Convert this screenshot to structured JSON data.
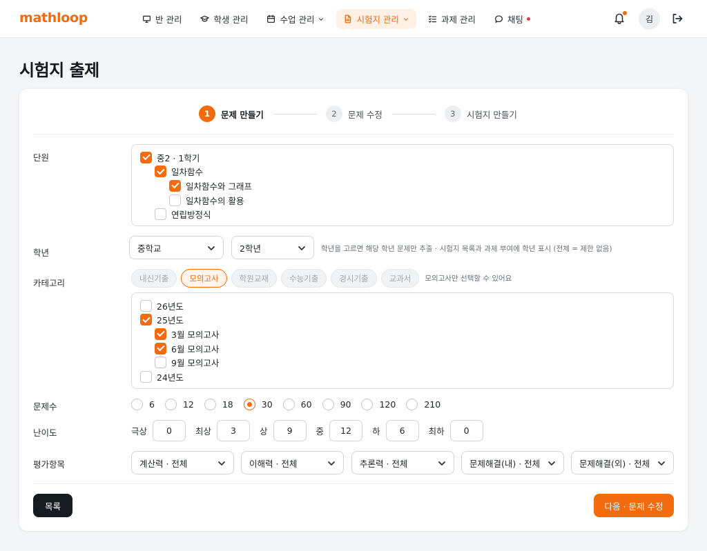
{
  "brand": {
    "logo": "mathloop",
    "accent": "#f26b0f"
  },
  "nav": {
    "items": [
      {
        "label": "반 관리",
        "icon": "monitor-icon"
      },
      {
        "label": "학생 관리",
        "icon": "graduation-cap-icon"
      },
      {
        "label": "수업 관리",
        "icon": "calendar-icon"
      },
      {
        "label": "시험지 관리",
        "icon": "document-icon"
      },
      {
        "label": "과제 관리",
        "icon": "checklist-icon"
      },
      {
        "label": "채팅",
        "icon": "chat-bubble-icon"
      }
    ],
    "active": "시험지 관리",
    "avatar": "김"
  },
  "page": {
    "title": "시험지 출제"
  },
  "stepper": {
    "steps": [
      {
        "num": "1",
        "label": "문제 만들기"
      },
      {
        "num": "2",
        "label": "문제 수정"
      },
      {
        "num": "3",
        "label": "시험지 만들기"
      }
    ],
    "current": "1"
  },
  "unit": {
    "label": "단원",
    "items": [
      {
        "label": "중2 · 1학기",
        "checked": true
      },
      {
        "label": "일차함수",
        "checked": true
      },
      {
        "label": "일차함수와 그래프",
        "checked": true
      },
      {
        "label": "일차함수의 활용",
        "checked": false
      },
      {
        "label": "연립방정식",
        "checked": false
      }
    ]
  },
  "grade": {
    "label": "학년",
    "school": "중학교",
    "year": "2학년",
    "hint": "학년을 고르면 해당 학년 문제만 추출 · 시험지 목록과 과제 부여에 학년 표시 (전체 = 제한 없음)"
  },
  "category": {
    "label": "카테고리",
    "chips": [
      "내신기출",
      "모의고사",
      "학원교재",
      "수능기출",
      "경시기출",
      "교과서"
    ],
    "active": "모의고사",
    "hint": "모의고사만 선택할 수 있어요",
    "items": [
      {
        "label": "26년도",
        "checked": false
      },
      {
        "label": "25년도",
        "checked": true
      },
      {
        "label": "3월 모의고사",
        "checked": true
      },
      {
        "label": "6월 모의고사",
        "checked": true
      },
      {
        "label": "9월 모의고사",
        "checked": false
      },
      {
        "label": "24년도",
        "checked": false
      }
    ]
  },
  "count": {
    "label": "문제수",
    "options": [
      "6",
      "12",
      "18",
      "30",
      "60",
      "90",
      "120",
      "210"
    ],
    "selected": "30"
  },
  "difficulty": {
    "label": "난이도",
    "levels": [
      {
        "name": "극상",
        "value": "0"
      },
      {
        "name": "최상",
        "value": "3"
      },
      {
        "name": "상",
        "value": "9"
      },
      {
        "name": "중",
        "value": "12"
      },
      {
        "name": "하",
        "value": "6"
      },
      {
        "name": "최하",
        "value": "0"
      }
    ]
  },
  "assessment": {
    "label": "평가항목",
    "selects": [
      "계산력 · 전체",
      "이해력 · 전체",
      "추론력 · 전체",
      "문제해결(내) · 전체",
      "문제해결(외) · 전체"
    ]
  },
  "actions": {
    "list": "목록",
    "next": "다음 · 문제 수정"
  }
}
